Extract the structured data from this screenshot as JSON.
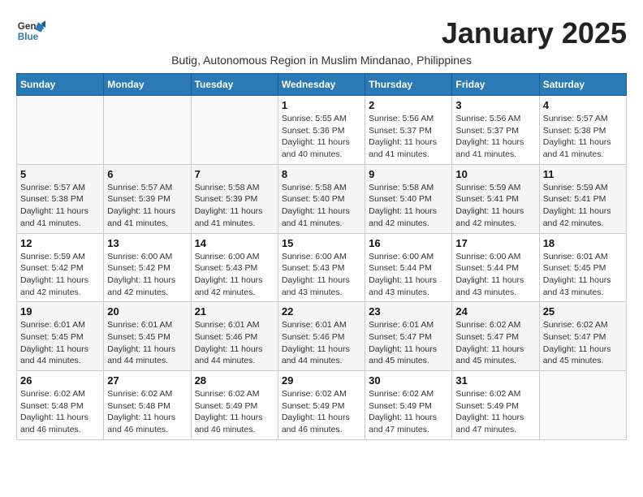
{
  "logo": {
    "general": "General",
    "blue": "Blue"
  },
  "title": "January 2025",
  "subtitle": "Butig, Autonomous Region in Muslim Mindanao, Philippines",
  "days_header": [
    "Sunday",
    "Monday",
    "Tuesday",
    "Wednesday",
    "Thursday",
    "Friday",
    "Saturday"
  ],
  "weeks": [
    [
      {
        "day": "",
        "info": ""
      },
      {
        "day": "",
        "info": ""
      },
      {
        "day": "",
        "info": ""
      },
      {
        "day": "1",
        "info": "Sunrise: 5:55 AM\nSunset: 5:36 PM\nDaylight: 11 hours and 40 minutes."
      },
      {
        "day": "2",
        "info": "Sunrise: 5:56 AM\nSunset: 5:37 PM\nDaylight: 11 hours and 41 minutes."
      },
      {
        "day": "3",
        "info": "Sunrise: 5:56 AM\nSunset: 5:37 PM\nDaylight: 11 hours and 41 minutes."
      },
      {
        "day": "4",
        "info": "Sunrise: 5:57 AM\nSunset: 5:38 PM\nDaylight: 11 hours and 41 minutes."
      }
    ],
    [
      {
        "day": "5",
        "info": "Sunrise: 5:57 AM\nSunset: 5:38 PM\nDaylight: 11 hours and 41 minutes."
      },
      {
        "day": "6",
        "info": "Sunrise: 5:57 AM\nSunset: 5:39 PM\nDaylight: 11 hours and 41 minutes."
      },
      {
        "day": "7",
        "info": "Sunrise: 5:58 AM\nSunset: 5:39 PM\nDaylight: 11 hours and 41 minutes."
      },
      {
        "day": "8",
        "info": "Sunrise: 5:58 AM\nSunset: 5:40 PM\nDaylight: 11 hours and 41 minutes."
      },
      {
        "day": "9",
        "info": "Sunrise: 5:58 AM\nSunset: 5:40 PM\nDaylight: 11 hours and 42 minutes."
      },
      {
        "day": "10",
        "info": "Sunrise: 5:59 AM\nSunset: 5:41 PM\nDaylight: 11 hours and 42 minutes."
      },
      {
        "day": "11",
        "info": "Sunrise: 5:59 AM\nSunset: 5:41 PM\nDaylight: 11 hours and 42 minutes."
      }
    ],
    [
      {
        "day": "12",
        "info": "Sunrise: 5:59 AM\nSunset: 5:42 PM\nDaylight: 11 hours and 42 minutes."
      },
      {
        "day": "13",
        "info": "Sunrise: 6:00 AM\nSunset: 5:42 PM\nDaylight: 11 hours and 42 minutes."
      },
      {
        "day": "14",
        "info": "Sunrise: 6:00 AM\nSunset: 5:43 PM\nDaylight: 11 hours and 42 minutes."
      },
      {
        "day": "15",
        "info": "Sunrise: 6:00 AM\nSunset: 5:43 PM\nDaylight: 11 hours and 43 minutes."
      },
      {
        "day": "16",
        "info": "Sunrise: 6:00 AM\nSunset: 5:44 PM\nDaylight: 11 hours and 43 minutes."
      },
      {
        "day": "17",
        "info": "Sunrise: 6:00 AM\nSunset: 5:44 PM\nDaylight: 11 hours and 43 minutes."
      },
      {
        "day": "18",
        "info": "Sunrise: 6:01 AM\nSunset: 5:45 PM\nDaylight: 11 hours and 43 minutes."
      }
    ],
    [
      {
        "day": "19",
        "info": "Sunrise: 6:01 AM\nSunset: 5:45 PM\nDaylight: 11 hours and 44 minutes."
      },
      {
        "day": "20",
        "info": "Sunrise: 6:01 AM\nSunset: 5:45 PM\nDaylight: 11 hours and 44 minutes."
      },
      {
        "day": "21",
        "info": "Sunrise: 6:01 AM\nSunset: 5:46 PM\nDaylight: 11 hours and 44 minutes."
      },
      {
        "day": "22",
        "info": "Sunrise: 6:01 AM\nSunset: 5:46 PM\nDaylight: 11 hours and 44 minutes."
      },
      {
        "day": "23",
        "info": "Sunrise: 6:01 AM\nSunset: 5:47 PM\nDaylight: 11 hours and 45 minutes."
      },
      {
        "day": "24",
        "info": "Sunrise: 6:02 AM\nSunset: 5:47 PM\nDaylight: 11 hours and 45 minutes."
      },
      {
        "day": "25",
        "info": "Sunrise: 6:02 AM\nSunset: 5:47 PM\nDaylight: 11 hours and 45 minutes."
      }
    ],
    [
      {
        "day": "26",
        "info": "Sunrise: 6:02 AM\nSunset: 5:48 PM\nDaylight: 11 hours and 46 minutes."
      },
      {
        "day": "27",
        "info": "Sunrise: 6:02 AM\nSunset: 5:48 PM\nDaylight: 11 hours and 46 minutes."
      },
      {
        "day": "28",
        "info": "Sunrise: 6:02 AM\nSunset: 5:49 PM\nDaylight: 11 hours and 46 minutes."
      },
      {
        "day": "29",
        "info": "Sunrise: 6:02 AM\nSunset: 5:49 PM\nDaylight: 11 hours and 46 minutes."
      },
      {
        "day": "30",
        "info": "Sunrise: 6:02 AM\nSunset: 5:49 PM\nDaylight: 11 hours and 47 minutes."
      },
      {
        "day": "31",
        "info": "Sunrise: 6:02 AM\nSunset: 5:49 PM\nDaylight: 11 hours and 47 minutes."
      },
      {
        "day": "",
        "info": ""
      }
    ]
  ]
}
